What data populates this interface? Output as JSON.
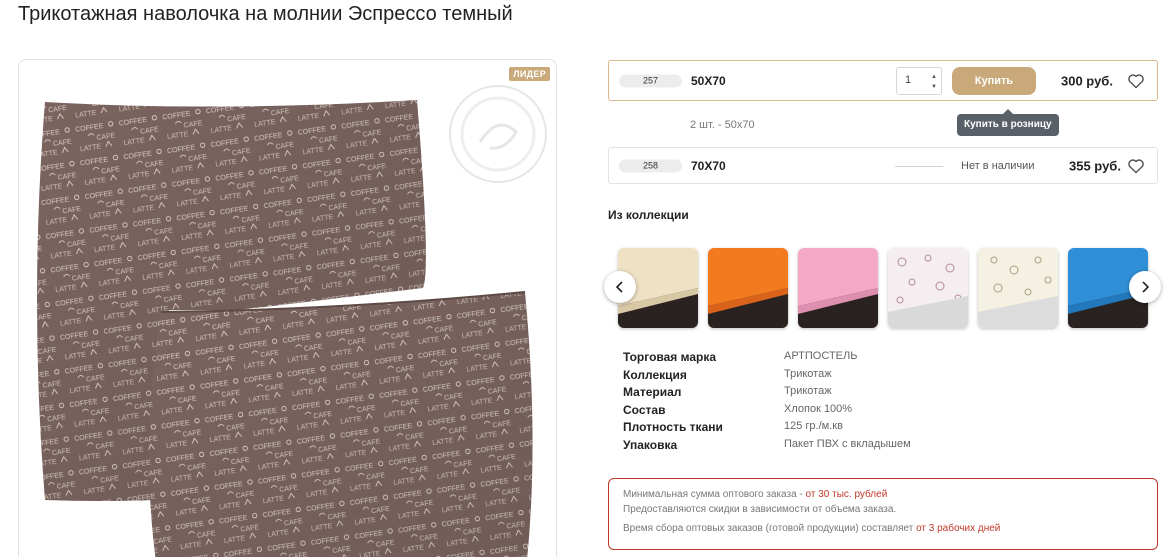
{
  "page": {
    "title": "Трикотажная наволочка на молнии Эспрессо темный"
  },
  "gallery": {
    "badge": "ЛИДЕР",
    "pattern_words": [
      "COFFEE",
      "CAFE",
      "LATTE"
    ]
  },
  "variants": [
    {
      "code": "257",
      "size": "50X70",
      "quantity": "1",
      "buy_label": "Купить",
      "price": "300 руб.",
      "in_stock": true,
      "pack_note": "2 шт. - 50x70",
      "tooltip": "Купить в розницу"
    },
    {
      "code": "258",
      "size": "70X70",
      "stock_text": "Нет в наличии",
      "price": "355 руб.",
      "in_stock": false
    }
  ],
  "collection": {
    "title": "Из коллекции",
    "items": [
      {
        "name": "cream-sheet",
        "color": "#efe2c4"
      },
      {
        "name": "orange-sheet",
        "color": "#f27a1f"
      },
      {
        "name": "pink-sheet",
        "color": "#f3a8c6"
      },
      {
        "name": "floral-sheet",
        "color": "#f4eef0"
      },
      {
        "name": "floral-yellow-sheet",
        "color": "#f4f0e2"
      },
      {
        "name": "blue-sheet",
        "color": "#2f8fd6"
      }
    ]
  },
  "specs": [
    {
      "key": "Торговая марка",
      "value": "АРТПОСТЕЛЬ"
    },
    {
      "key": "Коллекция",
      "value": "Трикотаж"
    },
    {
      "key": "Материал",
      "value": "Трикотаж"
    },
    {
      "key": "Состав",
      "value": "Хлопок 100%"
    },
    {
      "key": "Плотность ткани",
      "value": "125 гр./м.кв"
    },
    {
      "key": "Упаковка",
      "value": "Пакет ПВХ с вкладышем"
    }
  ],
  "notice": {
    "line1_text": "Минимальная сумма оптового заказа - ",
    "line1_accent": "от 30 тыс. рублей",
    "line2_text": "Предоставляются скидки в зависимости от объема заказа.",
    "line3_text": "Время сбора оптовых заказов (готовой продукции) составляет ",
    "line3_accent": "от 3 рабочих дней"
  },
  "colors": {
    "accent": "#c9a97a",
    "notice_accent": "#c0392b",
    "pillow_fabric": "#7b645f"
  }
}
